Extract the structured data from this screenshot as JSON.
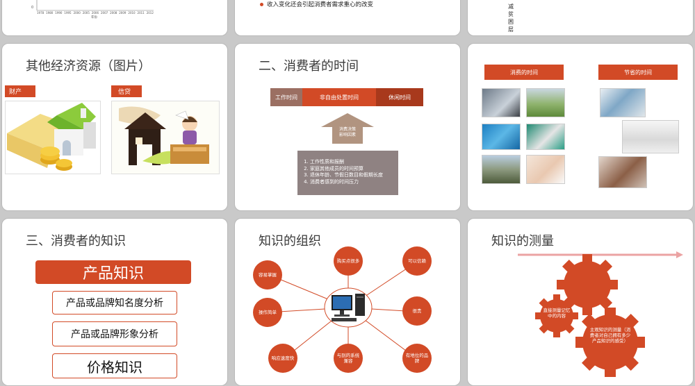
{
  "slide_top_left": {
    "x_axis_label": "年份",
    "zero_tick": "0",
    "years": [
      "1978",
      "1980",
      "1990",
      "1995",
      "2000",
      "2005",
      "2006",
      "2007",
      "2008",
      "2009",
      "2010",
      "2011",
      "2012"
    ]
  },
  "slide_top_mid": {
    "bullet": "收入变化还会引起消费者需求重心的改变"
  },
  "slide_top_right": {
    "vertical_text": [
      "减",
      "贫",
      "困",
      "层"
    ]
  },
  "slide_resources": {
    "title": "其他经济资源（图片）",
    "tag_assets": "财产",
    "tag_credit": "信贷"
  },
  "slide_time": {
    "title": "二、消费者的时间",
    "bar_segments": [
      "工作时间",
      "非自由处置时间",
      "休闲时间"
    ],
    "arrow_label_line1": "消费决策",
    "arrow_label_line2": "影响因素",
    "factors": [
      "工作性质和报酬",
      "家庭其他成员的时间预算",
      "退休年龄、节假日数目和假期长度",
      "消费者感到的时间压力"
    ],
    "colors": {
      "work": "#9b6f62",
      "nonfree": "#d24a26",
      "leisure": "#a8391c",
      "box": "#8f8282"
    }
  },
  "slide_time_photos": {
    "tag_consume": "消费的时间",
    "tag_save": "节省的时间"
  },
  "slide_knowledge": {
    "title": "三、消费者的知识",
    "header": "产品知识",
    "item1": "产品或品牌知名度分析",
    "item2": "产品或品牌形象分析",
    "item3": "价格知识"
  },
  "slide_organization": {
    "title": "知识的组织",
    "nodes": {
      "tl": "容易掌握",
      "tm": "购买点很多",
      "tr": "可以信赖",
      "ml": "操作简单",
      "mr": "很贵",
      "bl": "响应速度快",
      "bm": "与别的系统兼容",
      "br": "有地位的品牌"
    }
  },
  "slide_measure": {
    "title": "知识的测量",
    "gear_small": "直接测量记忆中的内容",
    "gear_big": "主观知识的测量（消费者对自己拥有多少产品知识的感受）"
  }
}
